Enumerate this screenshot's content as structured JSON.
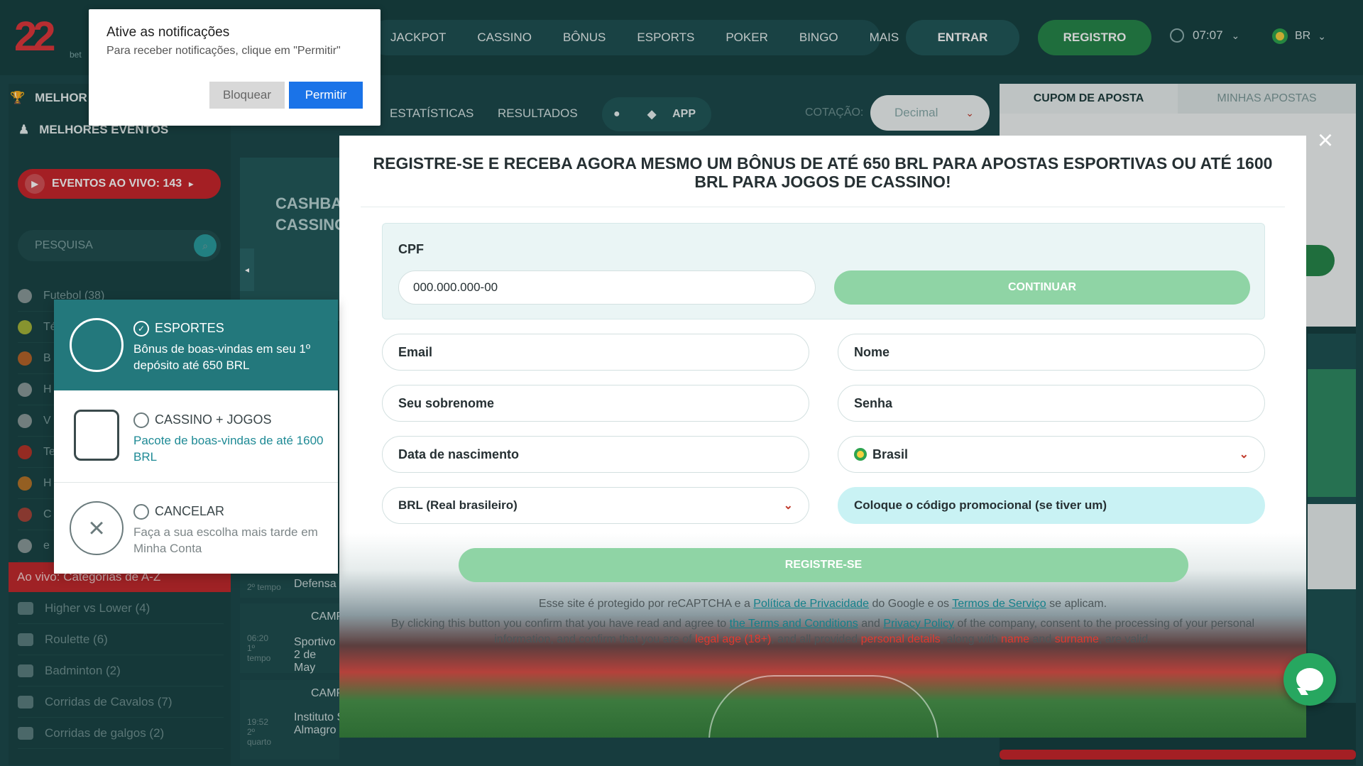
{
  "header": {
    "logo_text": "22",
    "logo_sub": "bet",
    "nav": [
      "JACKPOT",
      "CASSINO",
      "BÔNUS",
      "ESPORTS",
      "POKER",
      "BINGO",
      "MAIS"
    ],
    "login_label": "ENTRAR",
    "register_label": "REGISTRO",
    "time": "07:07",
    "language": "BR"
  },
  "sidebar": {
    "top_partial": "MELHOR",
    "best_events": "MELHORES EVENTOS",
    "live_events": "EVENTOS AO VIVO: 143",
    "search_placeholder": "PESQUISA",
    "sports": [
      "Futebol (38)",
      "Té",
      "B",
      "H",
      "V",
      "Te",
      "H",
      "C",
      "e"
    ],
    "live_categories_header": "Ao vivo: Categorias de A-Z",
    "categories": [
      "Higher vs Lower (4)",
      "Roulette (6)",
      "Badminton (2)",
      "Corridas de Cavalos (7)",
      "Corridas de galgos (2)"
    ]
  },
  "center": {
    "tabs": [
      "ESTATÍSTICAS",
      "RESULTADOS"
    ],
    "app_label": "APP",
    "odds_label": "COTAÇÃO:",
    "odds_value": "Decimal",
    "banner": "CASHBA CASSINO",
    "matches": [
      {
        "time": "2º tempo",
        "text": "Defensa"
      },
      {
        "time": "06:20 1º tempo",
        "league": "CAMP",
        "text": "Sportivo 2 de May"
      },
      {
        "time": "19:52 2º quarto",
        "league": "CAMP",
        "text": "Instituto San Lorenzo de Almagro Incluindo prorrogação"
      }
    ]
  },
  "coupon": {
    "tab_coupon": "CUPOM DE APOSTA",
    "tab_my_bets": "MINHAS APOSTAS"
  },
  "notification": {
    "title": "Ative as notificações",
    "text": "Para receber notificações, clique em \"Permitir\"",
    "block_label": "Bloquear",
    "allow_label": "Permitir"
  },
  "modal": {
    "title": "REGISTRE-SE E RECEBA AGORA MESMO UM BÔNUS DE ATÉ 650 BRL PARA APOSTAS ESPORTIVAS OU ATÉ 1600 BRL PARA JOGOS DE CASSINO!",
    "cpf_label": "CPF",
    "cpf_placeholder": "000.000.000-00",
    "continue_label": "CONTINUAR",
    "email": "Email",
    "name": "Nome",
    "surname": "Seu sobrenome",
    "password": "Senha",
    "birthdate": "Data de nascimento",
    "country": "Brasil",
    "currency": "BRL (Real brasileiro)",
    "promo": "Coloque o código promocional (se tiver um)",
    "register_label": "REGISTRE-SE",
    "recaptcha_1": "Esse site é protegido por reCAPTCHA e a",
    "recaptcha_privacy": "Política de Privacidade",
    "recaptcha_2": "do Google e os",
    "recaptcha_terms": "Termos de Serviço",
    "recaptcha_3": "se aplicam.",
    "consent_1": "By clicking this button you confirm that you have read and agree to",
    "consent_terms": "the Terms and Conditions",
    "consent_2": "and",
    "consent_privacy": "Privacy Policy",
    "consent_3": "of the company, consent to the processing of your personal information, and confirm that you are of",
    "consent_age": "legal age (18+)",
    "consent_4": ", and all provided",
    "consent_details": "personal details",
    "consent_5": ", along with",
    "consent_name": "name",
    "consent_6": "and",
    "consent_surname": "surname",
    "consent_7": ", are valid."
  },
  "bonus": {
    "sports_title": "ESPORTES",
    "sports_desc": "Bônus de boas-vindas em seu 1º depósito até 650 BRL",
    "casino_title": "CASSINO + JOGOS",
    "casino_desc": "Pacote de boas-vindas de até 1600 BRL",
    "cancel_title": "CANCELAR",
    "cancel_desc": "Faça a sua escolha mais tarde em Minha Conta"
  },
  "colors": {
    "primary_green": "#27874b",
    "accent_red": "#c8272d",
    "teal": "#23787c"
  }
}
